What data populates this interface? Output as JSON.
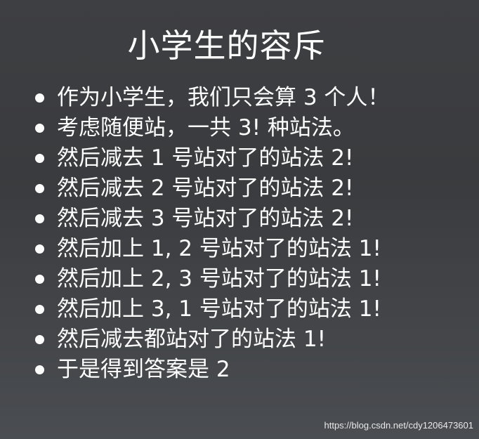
{
  "slide": {
    "title": "小学生的容斥",
    "bullets": [
      "作为小学生，我们只会算 3 个人！",
      "考虑随便站，一共 3! 种站法。",
      "然后减去 1 号站对了的站法 2!",
      "然后减去 2 号站对了的站法 2!",
      "然后减去 3 号站对了的站法 2!",
      "然后加上 1, 2 号站对了的站法 1!",
      "然后加上 2, 3 号站对了的站法 1!",
      "然后加上 3, 1 号站对了的站法 1!",
      "然后减去都站对了的站法 1!",
      "于是得到答案是 2"
    ],
    "watermark": "https://blog.csdn.net/cdy1206473601"
  },
  "colors": {
    "background": "#3e3f42",
    "text": "#ffffff"
  },
  "icons": {
    "bullet": "bullet-dot-icon"
  }
}
